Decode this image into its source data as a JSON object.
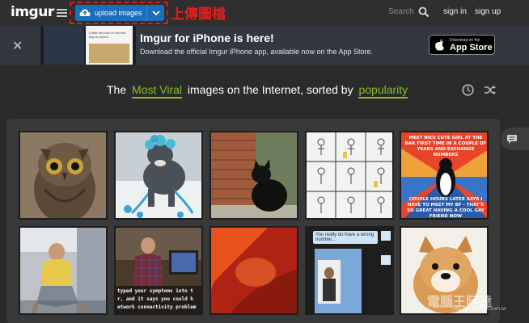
{
  "topbar": {
    "logo": "imgur",
    "upload_label": "upload images",
    "annotation": "上傳圖檔",
    "search_placeholder": "Search",
    "signin": "sign in",
    "signup": "sign up"
  },
  "banner": {
    "title": "Imgur for iPhone is here!",
    "subtitle": "Download the official Imgur iPhone app, available now on the App Store.",
    "close": "✕",
    "appstore_small": "Download on the",
    "appstore_big": "App Store",
    "phone_text": "A little nervous on his first day at school"
  },
  "heading": {
    "prefix": "The",
    "sort_filter": "Most Viral",
    "middle": "images on the Internet, sorted by",
    "sort_by": "popularity"
  },
  "gallery": {
    "meme_top": "MEET NICE CUTE GIRL AT THE BAR FIRST TIME IN A COUPLE OF YEARS AND EXCHANGE NUMBERS",
    "meme_bottom": "COUPLE HOURS LATER SAYS I HAVE TO MEET MY BF - THAT'S SO GREAT HAVING A COOL GAY FRIEND NOW",
    "chat_text": "You really do have a wrong number...",
    "terminal_line1": "typed your symptoms into t",
    "terminal_line2": "r, and it says you could h",
    "terminal_line3": "etwork connectivity problem"
  },
  "watermark": {
    "text": "電腦王阿達",
    "url": "http://www.kocpc.com.tw"
  },
  "colors": {
    "accent_green": "#85bf25",
    "upload_blue": "#1c6fb7",
    "annotation_red": "#e01a1a"
  }
}
